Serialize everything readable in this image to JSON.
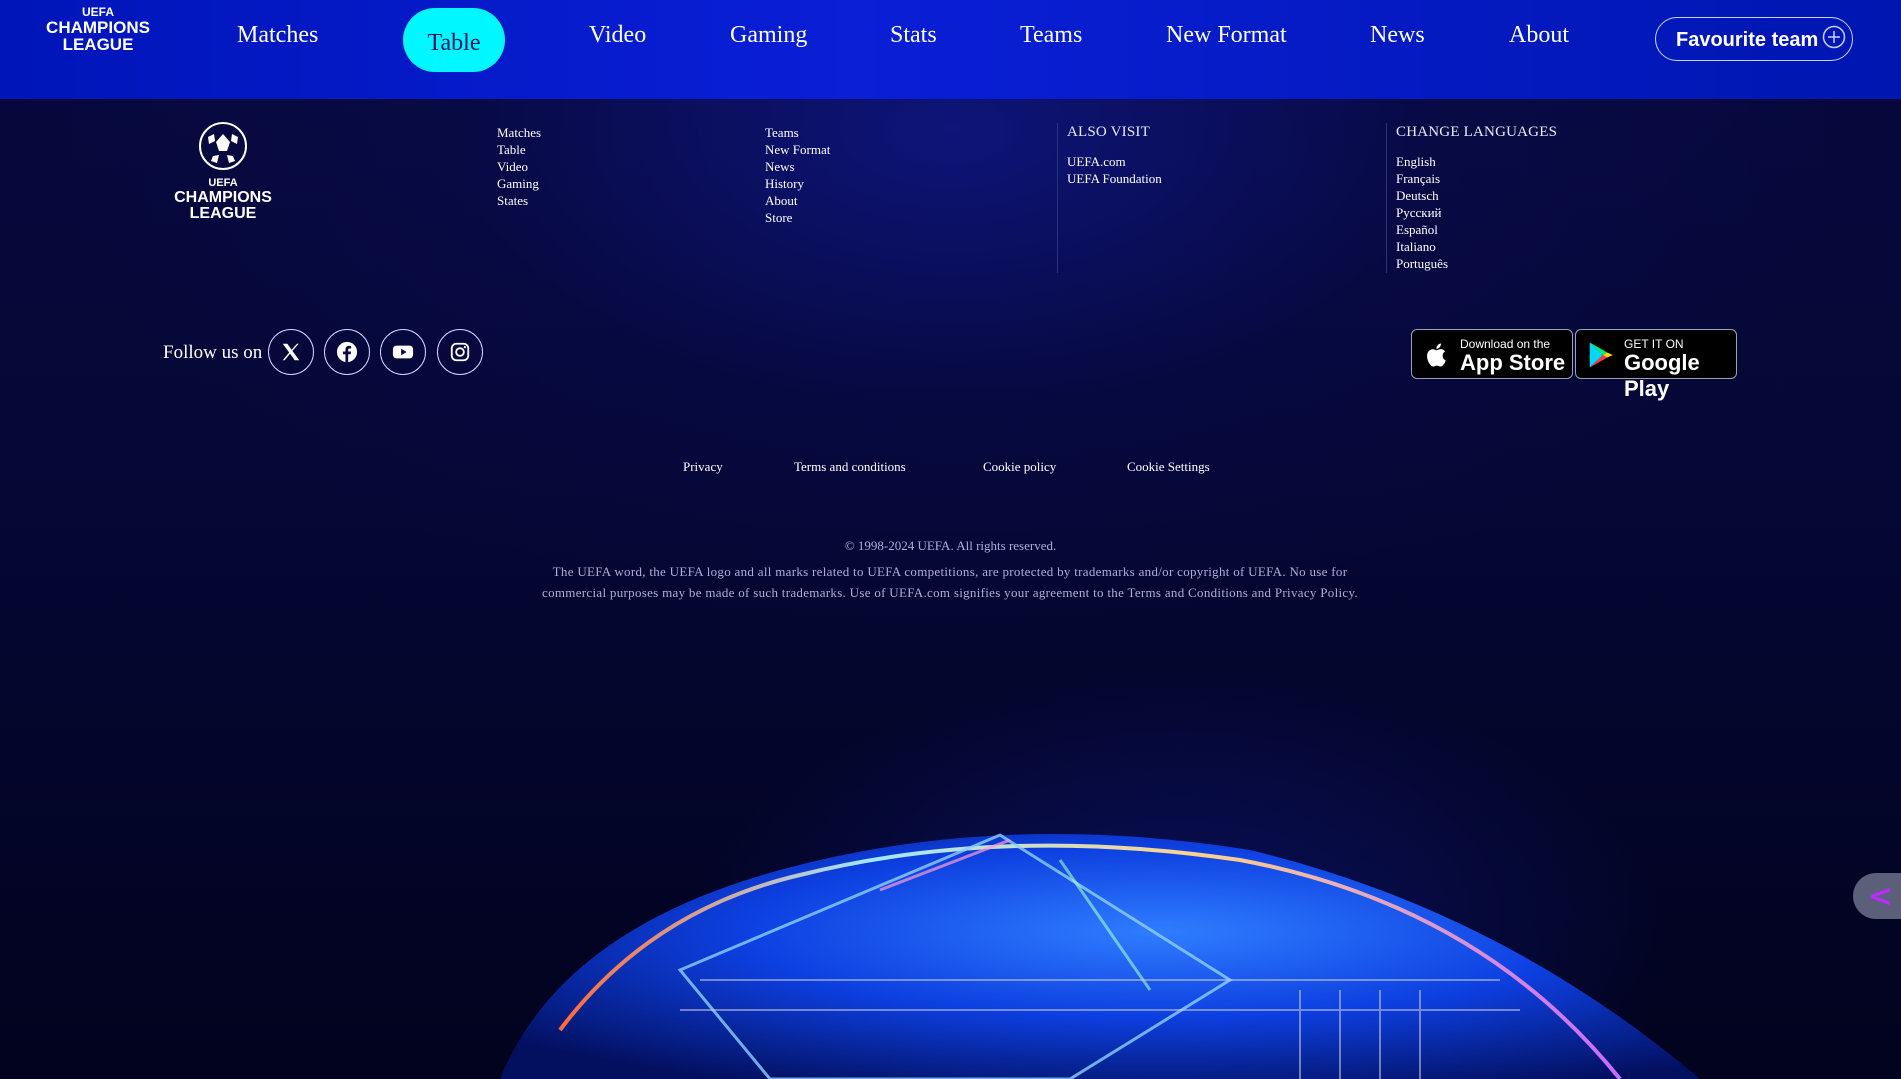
{
  "header": {
    "logo_text": [
      "UEFA",
      "CHAMPIONS",
      "LEAGUE"
    ],
    "nav": [
      {
        "label": "Matches"
      },
      {
        "label": "Table",
        "active": true
      },
      {
        "label": "Video"
      },
      {
        "label": "Gaming"
      },
      {
        "label": "Stats"
      },
      {
        "label": "Teams"
      },
      {
        "label": "New Format"
      },
      {
        "label": "News"
      },
      {
        "label": "About"
      }
    ],
    "favourite_label": "Favourite team",
    "active_pill_color": "#00f7ff"
  },
  "footer": {
    "logo_text": [
      "UEFA",
      "CHAMPIONS",
      "LEAGUE"
    ],
    "col1": [
      "Matches",
      "Table",
      "Video",
      "Gaming",
      "States"
    ],
    "col2": [
      "Teams",
      "New Format",
      "News",
      "History",
      "About",
      "Store"
    ],
    "also_visit": {
      "title": "ALSO VISIT",
      "links": [
        "UEFA.com",
        "UEFA Foundation"
      ]
    },
    "languages": {
      "title": "CHANGE LANGUAGES",
      "links": [
        "English",
        "Français",
        "Deutsch",
        "Русский",
        "Español",
        "Italiano",
        "Português"
      ]
    },
    "follow_label": "Follow us on",
    "social_icons": [
      "x-icon",
      "facebook-icon",
      "youtube-icon",
      "instagram-icon"
    ],
    "app_store": {
      "small": "Download on the",
      "big": "App Store"
    },
    "google_play": {
      "small": "GET IT ON",
      "big": "Google Play"
    },
    "legal_links": [
      "Privacy",
      "Terms and conditions",
      "Cookie policy",
      "Cookie Settings"
    ],
    "copyright": "© 1998-2024 UEFA. All rights reserved.",
    "notice_line1": "The UEFA word, the UEFA logo and all marks related to UEFA competitions, are protected by trademarks and/or copyright of UEFA. No use for",
    "notice_line2": "commercial purposes may be made of such trademarks. Use of UEFA.com signifies your agreement to the Terms and Conditions and Privacy Policy."
  },
  "side_tab_glyph": "<"
}
